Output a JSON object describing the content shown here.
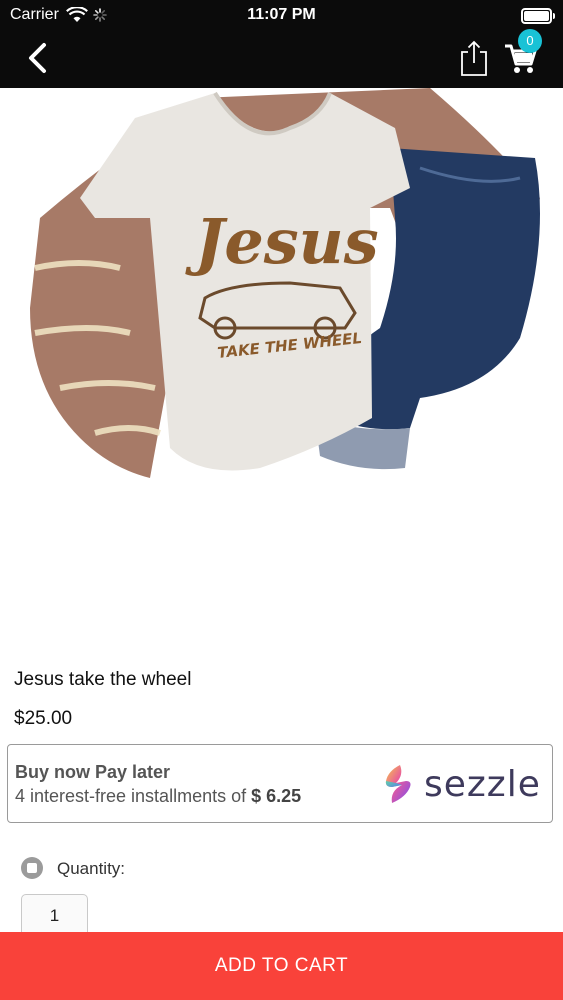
{
  "status_bar": {
    "carrier": "Carrier",
    "time": "11:07 PM",
    "battery_level": 1.0
  },
  "nav": {
    "back_icon": "chevron-left-icon",
    "share_icon": "share-icon",
    "cart_icon": "cart-icon",
    "cart_count": "0"
  },
  "product": {
    "image_text_line1": "Jesus",
    "image_text_line2": "TAKE THE WHEEL",
    "title": "Jesus take the wheel",
    "price": "$25.00"
  },
  "sezzle": {
    "headline": "Buy now Pay later",
    "sub_prefix": "4 interest-free installments of",
    "installment": "$ 6.25",
    "brand": "sezzle"
  },
  "quantity": {
    "label": "Quantity:",
    "value": "1"
  },
  "cta": {
    "label": "ADD TO CART"
  },
  "colors": {
    "topbar": "#0b0b0b",
    "badge": "#19c2d6",
    "cta": "#f9423a"
  }
}
